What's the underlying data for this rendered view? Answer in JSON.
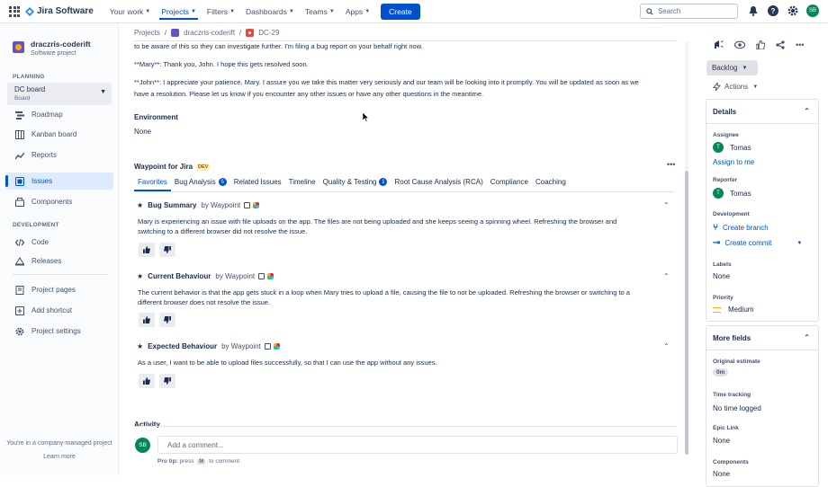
{
  "topbar": {
    "product_name": "Jira Software",
    "nav": [
      {
        "label": "Your work",
        "active": false
      },
      {
        "label": "Projects",
        "active": true
      },
      {
        "label": "Filters",
        "active": false
      },
      {
        "label": "Dashboards",
        "active": false
      },
      {
        "label": "Teams",
        "active": false
      },
      {
        "label": "Apps",
        "active": false
      }
    ],
    "create_label": "Create",
    "search_placeholder": "Search",
    "avatar_initials": "SB"
  },
  "sidebar": {
    "project_name": "draczris-coderift",
    "project_type": "Software project",
    "planning_header": "PLANNING",
    "board_name": "DC board",
    "board_sub": "Board",
    "planning_items": [
      {
        "label": "Roadmap",
        "icon": "roadmap-icon"
      },
      {
        "label": "Kanban board",
        "icon": "kanban-icon"
      },
      {
        "label": "Reports",
        "icon": "reports-icon"
      },
      {
        "label": "Issues",
        "icon": "issues-icon",
        "active": true
      },
      {
        "label": "Components",
        "icon": "components-icon"
      }
    ],
    "development_header": "DEVELOPMENT",
    "development_items": [
      {
        "label": "Code",
        "icon": "code-icon"
      },
      {
        "label": "Releases",
        "icon": "releases-icon"
      }
    ],
    "other_items": [
      {
        "label": "Project pages",
        "icon": "pages-icon"
      },
      {
        "label": "Add shortcut",
        "icon": "add-shortcut-icon"
      },
      {
        "label": "Project settings",
        "icon": "settings-icon"
      }
    ],
    "footer_text": "You're in a company-managed project",
    "learn_more": "Learn more"
  },
  "breadcrumb": {
    "projects": "Projects",
    "project": "draczris-coderift",
    "issue": "DC-29"
  },
  "description": {
    "line1": "to be aware of this so they can investigate further. I'm filing a bug report on your behalf right now.",
    "line2": "**Mary**: Thank you, John. I hope this gets resolved soon.",
    "line3a": "**John**: I appreciate your patience, Mary. I assure you we take this matter very seriously and our team will be looking into it promptly. You will be updated as soon as we",
    "line3b": "have a resolution. Please let us know if you encounter any other issues or have any other questions in the meantime."
  },
  "environment": {
    "label": "Environment",
    "value": "None"
  },
  "waypoint": {
    "title": "Waypoint for Jira",
    "dev_badge": "DEV",
    "tabs": [
      {
        "label": "Favorites",
        "active": true,
        "count": ""
      },
      {
        "label": "Bug Analysis",
        "count": "5"
      },
      {
        "label": "Related Issues",
        "count": ""
      },
      {
        "label": "Timeline",
        "count": ""
      },
      {
        "label": "Quality & Testing",
        "count": "1"
      },
      {
        "label": "Root Cause Analysis (RCA)",
        "count": ""
      },
      {
        "label": "Compliance",
        "count": ""
      },
      {
        "label": "Coaching",
        "count": ""
      }
    ],
    "cards": [
      {
        "title": "Bug Summary",
        "by": "by Waypoint",
        "text_a": "Mary is experiencing an issue with file uploads on the app. The files are not being uploaded and she keeps seeing a spinning wheel. Refreshing the browser and",
        "text_b": "switching to a different browser did not resolve the issue."
      },
      {
        "title": "Current Behaviour",
        "by": "by Waypoint",
        "text_a": "The current behavior is that the app gets stuck in a loop when Mary tries to upload a file, causing the file to not be uploaded. Refreshing the browser or switching to a",
        "text_b": "different browser does not resolve the issue."
      },
      {
        "title": "Expected Behaviour",
        "by": "by Waypoint",
        "text_a": "As a user, I want to be able to upload files successfully, so that I can use the app without any issues.",
        "text_b": ""
      }
    ]
  },
  "activity": {
    "label": "Activity",
    "avatar_initials": "SB",
    "comment_placeholder": "Add a comment...",
    "tip_prefix": "Pro tip:",
    "tip_press": "press",
    "tip_key": "M",
    "tip_suffix": "to comment"
  },
  "right_panel": {
    "status": "Backlog",
    "actions": "Actions",
    "details": {
      "header": "Details",
      "assignee_label": "Assignee",
      "assignee": "Tomas",
      "assignee_initial": "T",
      "assign_to_me": "Assign to me",
      "reporter_label": "Reporter",
      "reporter": "Tomas",
      "reporter_initial": "T",
      "development_label": "Development",
      "create_branch": "Create branch",
      "create_commit": "Create commit",
      "labels_label": "Labels",
      "labels_value": "None",
      "priority_label": "Priority",
      "priority_value": "Medium"
    },
    "more_fields": {
      "header": "More fields",
      "original_estimate_label": "Original estimate",
      "original_estimate": "0m",
      "time_tracking_label": "Time tracking",
      "time_tracking": "No time logged",
      "epic_link_label": "Epic Link",
      "epic_link": "None",
      "components_label": "Components",
      "components": "None"
    }
  },
  "colors": {
    "accent": "#0052cc",
    "avatar": "#00875a",
    "priority_medium": "#ffab00"
  }
}
